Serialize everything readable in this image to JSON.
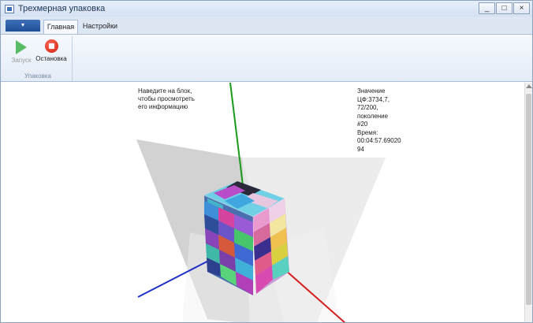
{
  "window": {
    "title": "Трехмерная упаковка",
    "controls": {
      "minimize": "_",
      "maximize": "□",
      "close": "×"
    }
  },
  "ribbon": {
    "tabs": [
      {
        "label": "Главная",
        "active": true
      },
      {
        "label": "Настройки",
        "active": false
      }
    ],
    "group": {
      "label": "Упаковка",
      "buttons": [
        {
          "label": "Запуск",
          "icon": "play-icon",
          "enabled": false
        },
        {
          "label": "Остановка",
          "icon": "stop-icon",
          "enabled": true
        }
      ]
    }
  },
  "viewport": {
    "hover_info": "Наведите на блок, чтобы просмотреть его информацию",
    "status": {
      "line1": "Значение",
      "line2": "ЦФ:3734,7,",
      "line3": "72/200,",
      "line4": "поколение",
      "line5": "#20",
      "line6": "Время:",
      "line7": "00:04:57.69020",
      "line8": "94"
    },
    "axis_colors": {
      "x": "#d42020",
      "y": "#1a9a1a",
      "z": "#2030c8"
    }
  }
}
